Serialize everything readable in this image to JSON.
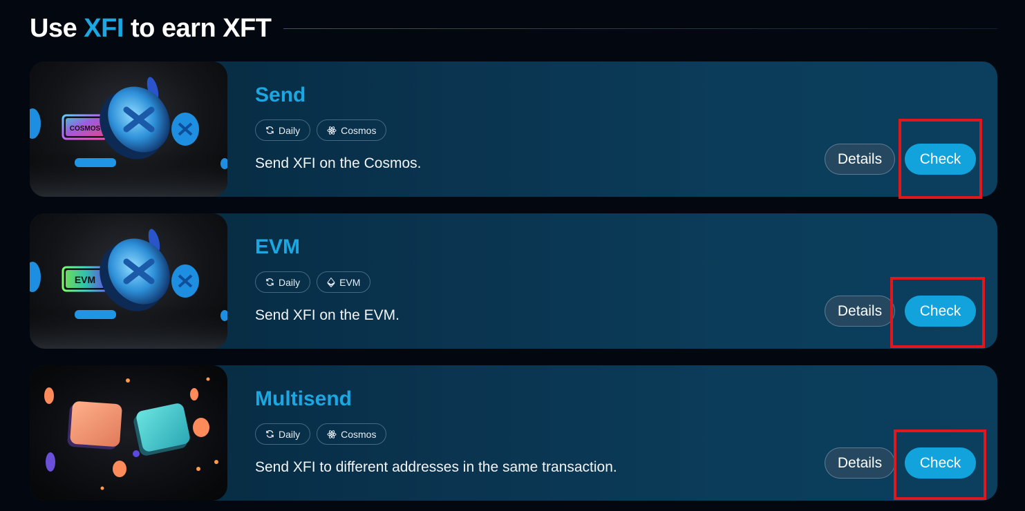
{
  "header": {
    "title_prefix": "Use ",
    "title_accent": "XFI",
    "title_suffix": " to earn XFT"
  },
  "tasks": [
    {
      "title": "Send",
      "tags": [
        {
          "label": "Daily",
          "icon": "refresh-icon"
        },
        {
          "label": "Cosmos",
          "icon": "cosmos-icon"
        }
      ],
      "description": "Send XFI on the Cosmos.",
      "thumbnail_badge": "COSMOS",
      "details_label": "Details",
      "check_label": "Check"
    },
    {
      "title": "EVM",
      "tags": [
        {
          "label": "Daily",
          "icon": "refresh-icon"
        },
        {
          "label": "EVM",
          "icon": "ethereum-icon"
        }
      ],
      "description": "Send XFI on the EVM.",
      "thumbnail_badge": "EVM",
      "details_label": "Details",
      "check_label": "Check"
    },
    {
      "title": "Multisend",
      "tags": [
        {
          "label": "Daily",
          "icon": "refresh-icon"
        },
        {
          "label": "Cosmos",
          "icon": "cosmos-icon"
        }
      ],
      "description": "Send XFI to different addresses in the same transaction.",
      "details_label": "Details",
      "check_label": "Check"
    }
  ],
  "colors": {
    "accent": "#1ba7e2",
    "check_button": "#12a3dc",
    "highlight": "#e0181d",
    "background": "#03070f"
  }
}
